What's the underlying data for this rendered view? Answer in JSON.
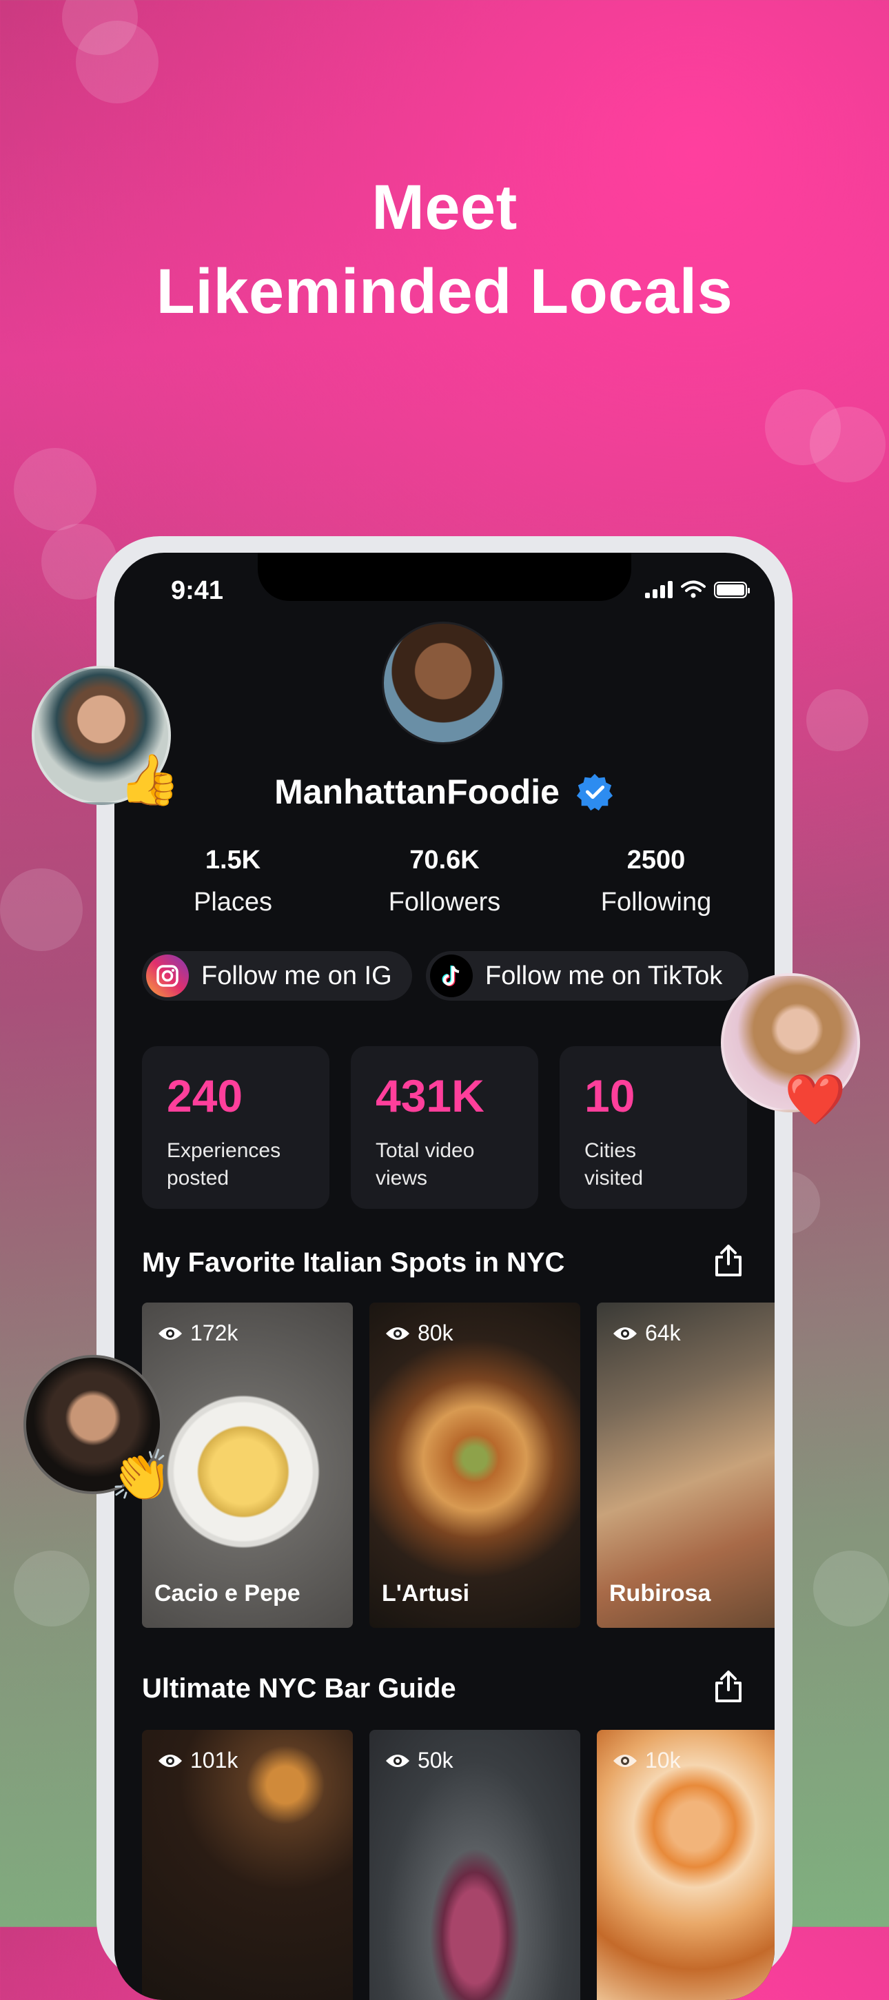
{
  "headline": {
    "line1": "Meet",
    "line2": "Likeminded Locals"
  },
  "status_bar": {
    "time": "9:41"
  },
  "profile": {
    "username": "ManhattanFoodie",
    "stats": [
      {
        "value": "1.5K",
        "label": "Places"
      },
      {
        "value": "70.6K",
        "label": "Followers"
      },
      {
        "value": "2500",
        "label": "Following"
      }
    ],
    "social": [
      {
        "label": "Follow me on IG",
        "icon": "instagram-icon"
      },
      {
        "label": "Follow me on TikTok",
        "icon": "tiktok-icon"
      }
    ],
    "cards": [
      {
        "value": "240",
        "label": "Experiences posted"
      },
      {
        "value": "431K",
        "label": "Total video views"
      },
      {
        "value": "10",
        "label": "Cities visited"
      }
    ]
  },
  "sections": [
    {
      "title": "My Favorite Italian Spots in NYC",
      "tiles": [
        {
          "views": "172k",
          "name": "Cacio e Pepe"
        },
        {
          "views": "80k",
          "name": "L'Artusi"
        },
        {
          "views": "64k",
          "name": "Rubirosa"
        }
      ]
    },
    {
      "title": "Ultimate NYC Bar Guide",
      "tiles": [
        {
          "views": "101k",
          "name": ""
        },
        {
          "views": "50k",
          "name": ""
        },
        {
          "views": "10k",
          "name": ""
        }
      ]
    }
  ],
  "colors": {
    "accent": "#ff3f9b",
    "verified": "#2d8cf0",
    "screen_bg": "#0e0f12",
    "card_bg": "#1a1b20"
  },
  "floating_reactions": [
    "thumbs-up",
    "heart",
    "clapping-hands"
  ]
}
